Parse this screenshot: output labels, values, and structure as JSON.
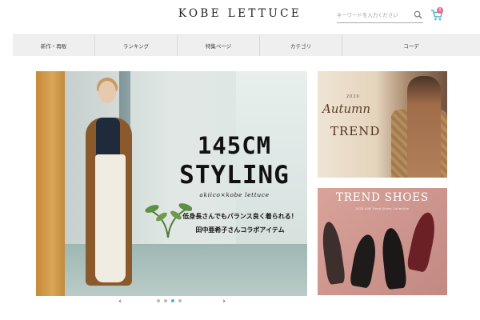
{
  "header": {
    "logo": "KOBE LETTUCE",
    "search_placeholder": "キーワードを入力ください",
    "cart_count": "0"
  },
  "nav": {
    "items": [
      {
        "label": "新作・再販"
      },
      {
        "label": "ランキング"
      },
      {
        "label": "特集ページ"
      },
      {
        "label": "カテゴリ"
      },
      {
        "label": "コーデ"
      }
    ]
  },
  "main_banner": {
    "headline_line1": "145CM",
    "headline_line2": "STYLING",
    "subtitle": "akiico×kobe lettuce",
    "copy_line1": "低身長さんでもバランス良く着られる！",
    "copy_line2": "田中亜希子さんコラボアイテム"
  },
  "carousel": {
    "prev": "‹",
    "next": "›",
    "slide_count": 4,
    "active_index": 2
  },
  "side_banners": {
    "autumn": {
      "year": "2020",
      "script": "Autumn",
      "title": "TREND"
    },
    "shoes": {
      "title": "TREND SHOES",
      "subtitle": "2020 A/W Trend Shoes Collection"
    }
  },
  "colors": {
    "accent": "#4ab5c9",
    "badge": "#e96686",
    "nav_bg": "#efefef"
  }
}
